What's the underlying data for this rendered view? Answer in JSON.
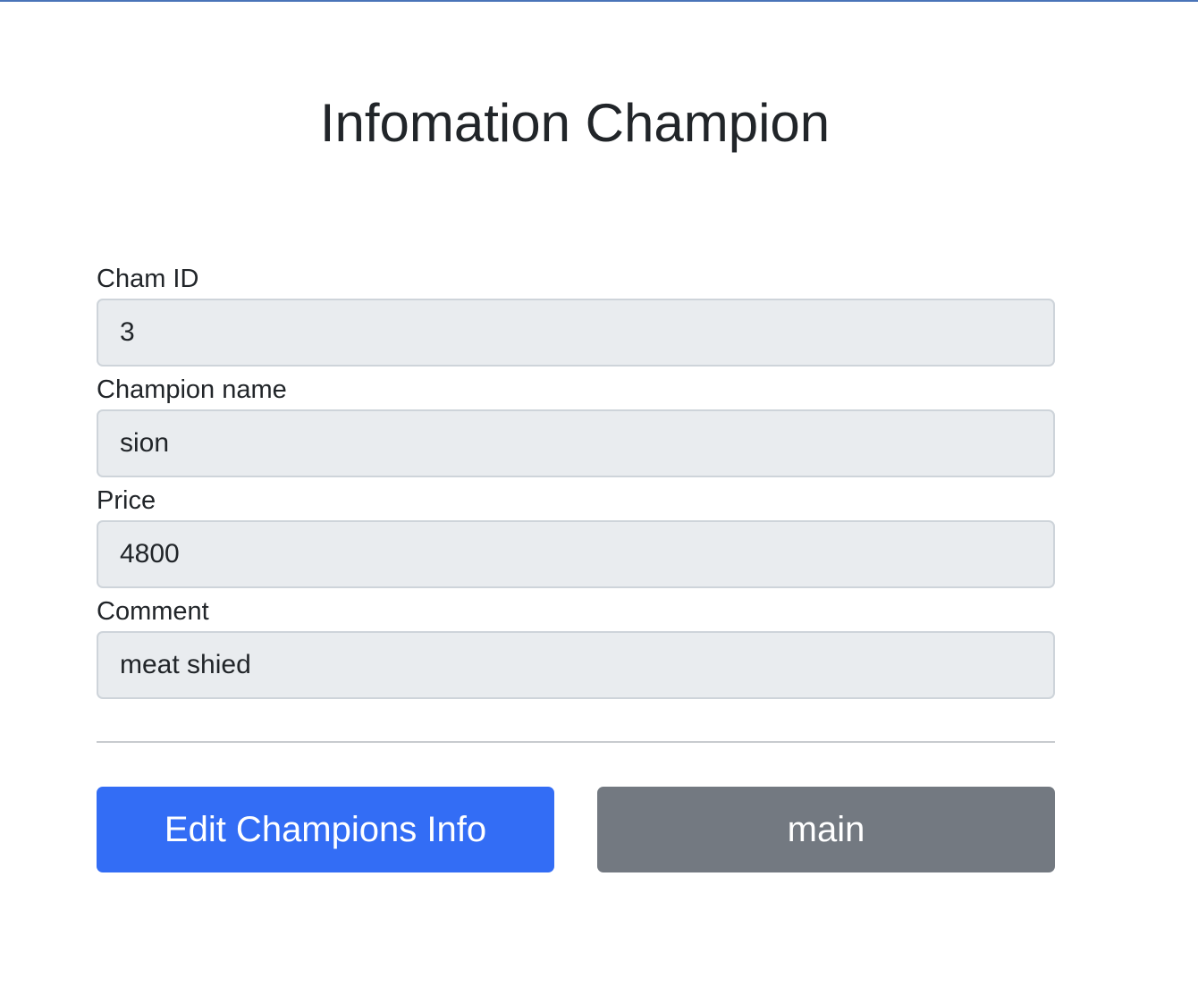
{
  "page": {
    "title": "Infomation Champion"
  },
  "form": {
    "fields": [
      {
        "label": "Cham ID",
        "value": "3"
      },
      {
        "label": "Champion name",
        "value": "sion"
      },
      {
        "label": "Price",
        "value": "4800"
      },
      {
        "label": "Comment",
        "value": "meat shied"
      }
    ]
  },
  "actions": {
    "edit_label": "Edit Champions Info",
    "main_label": "main"
  },
  "colors": {
    "primary": "#336df5",
    "secondary": "#737981",
    "input_background": "#e9ecef",
    "text": "#212529"
  }
}
